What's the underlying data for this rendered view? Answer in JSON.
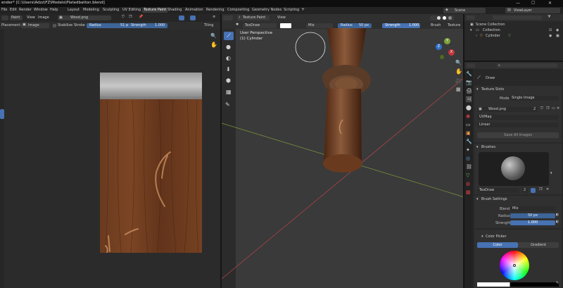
{
  "title_bar": {
    "title": "ender* [C:\\Users\\Adzz\\FZ\\Models\\Platedbatton.blend]",
    "min_icon": "—",
    "max_icon": "▢",
    "close_icon": "✕"
  },
  "menu": [
    "File",
    "Edit",
    "Render",
    "Window",
    "Help"
  ],
  "workspaces": [
    "Layout",
    "Modeling",
    "Sculpting",
    "UV Editing",
    "Texture Paint",
    "Shading",
    "Animation",
    "Rendering",
    "Compositing",
    "Geometry Nodes",
    "Scripting"
  ],
  "workspace_add": "+",
  "scene": {
    "label": "Scene",
    "view_layer": "ViewLayer"
  },
  "image_editor": {
    "mode": "Paint",
    "menus": [
      "View",
      "Image"
    ],
    "image_name": "Wood.png",
    "placement_label": "Placement:",
    "placement_value": "Image",
    "stabilize": "Stabilize Stroke",
    "radius_label": "Radius",
    "radius_value": "51 px",
    "strength_label": "Strength",
    "strength_value": "1.000",
    "tiling": "Tiling"
  },
  "viewport": {
    "mode": "Texture Paint",
    "view_menu": "View",
    "brush_name": "TexDraw",
    "blend": "Mix",
    "radius_label": "Radius",
    "radius_value": "50 px",
    "strength_label": "Strength",
    "strength_value": "1.000",
    "brush_menu": "Brush",
    "texture_menu": "Texture",
    "perspective": "User Perspective",
    "object": "(1) Cylinder",
    "gizmo_x": "X",
    "gizmo_y": "Y",
    "gizmo_z": "Z"
  },
  "outliner": {
    "scene_collection": "Scene Collection",
    "collection": "Collection",
    "object": "Cylinder"
  },
  "properties": {
    "search_placeholder": "",
    "tool_name": "Draw",
    "texture_slots": {
      "header": "Texture Slots",
      "mode_label": "Mode",
      "mode_value": "Single Image",
      "image": "Wood.png",
      "image_users": "2",
      "uv_map": "UVMap",
      "interpolation": "Linear",
      "save_button": "Save All Images"
    },
    "brushes": {
      "header": "Brushes",
      "brush_name": "TexDraw",
      "users": "2"
    },
    "brush_settings": {
      "header": "Brush Settings",
      "blend_label": "Blend",
      "blend_value": "Mix",
      "radius_label": "Radius",
      "radius_value": "50 px",
      "strength_label": "Strength",
      "strength_value": "1.000"
    },
    "color_picker": {
      "header": "Color Picker",
      "tab_color": "Color",
      "tab_gradient": "Gradient"
    }
  },
  "colors": {
    "accent": "#4772b3",
    "active_tab": "#3d3d3d",
    "axis_x": "#c3373e",
    "axis_y": "#7ca33a",
    "axis_z": "#2f72c8"
  }
}
